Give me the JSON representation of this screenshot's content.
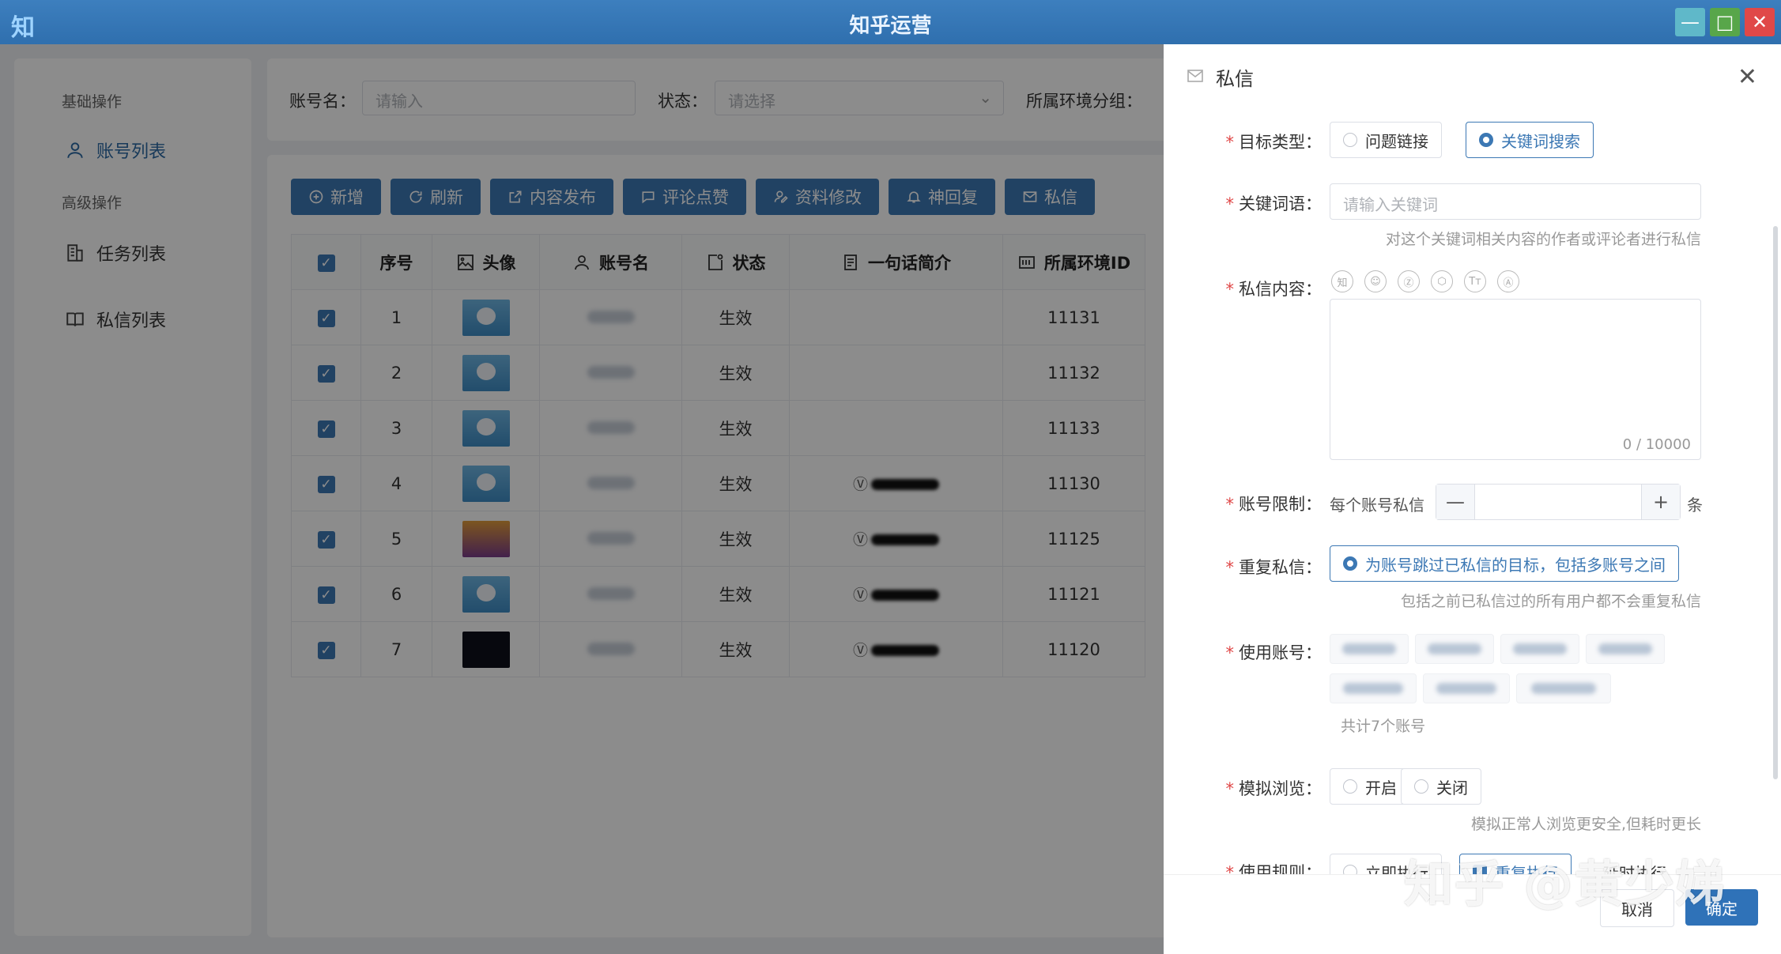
{
  "window": {
    "logo": "知",
    "title": "知乎运营",
    "controls": {
      "minimize": "—",
      "maximize": "□",
      "close": "✕"
    }
  },
  "sidebar": {
    "groups": [
      {
        "label": "基础操作"
      },
      {
        "label": "高级操作"
      }
    ],
    "items": [
      {
        "label": "账号列表",
        "icon": "user-icon"
      },
      {
        "label": "任务列表",
        "icon": "building-icon"
      },
      {
        "label": "私信列表",
        "icon": "book-icon"
      }
    ]
  },
  "filter": {
    "account_label": "账号名：",
    "account_placeholder": "请输入",
    "status_label": "状态：",
    "status_placeholder": "请选择",
    "env_label": "所属环境分组："
  },
  "toolbar": {
    "buttons": [
      {
        "label": "新增",
        "icon": "plus-circle-icon"
      },
      {
        "label": "刷新",
        "icon": "refresh-icon"
      },
      {
        "label": "内容发布",
        "icon": "external-link-icon"
      },
      {
        "label": "评论点赞",
        "icon": "comment-icon"
      },
      {
        "label": "资料修改",
        "icon": "edit-profile-icon"
      },
      {
        "label": "神回复",
        "icon": "bell-icon"
      },
      {
        "label": "私信",
        "icon": "mail-icon"
      }
    ]
  },
  "table": {
    "headers": {
      "index": "序号",
      "avatar": "头像",
      "account": "账号名",
      "status": "状态",
      "bio": "一句话简介",
      "env_id": "所属环境ID"
    },
    "rows": [
      {
        "index": "1",
        "status": "生效",
        "env_id": "11131",
        "avatar": "bear",
        "has_bio": false
      },
      {
        "index": "2",
        "status": "生效",
        "env_id": "11132",
        "avatar": "bear",
        "has_bio": false
      },
      {
        "index": "3",
        "status": "生效",
        "env_id": "11133",
        "avatar": "bear",
        "has_bio": false
      },
      {
        "index": "4",
        "status": "生效",
        "env_id": "11130",
        "avatar": "bear",
        "has_bio": true
      },
      {
        "index": "5",
        "status": "生效",
        "env_id": "11125",
        "avatar": "orange",
        "has_bio": true
      },
      {
        "index": "6",
        "status": "生效",
        "env_id": "11121",
        "avatar": "bear",
        "has_bio": true
      },
      {
        "index": "7",
        "status": "生效",
        "env_id": "11120",
        "avatar": "dark",
        "has_bio": true
      }
    ],
    "bio_prefix": "Ⓥ",
    "check_mark": "✓"
  },
  "drawer": {
    "title": "私信",
    "close": "✕",
    "target_type": {
      "label": "目标类型：",
      "options": [
        "问题链接",
        "关键词搜索"
      ],
      "selected": "关键词搜索"
    },
    "keyword": {
      "label": "关键词语：",
      "placeholder": "请输入关键词",
      "hint": "对这个关键词相关内容的作者或评论者进行私信"
    },
    "content": {
      "label": "私信内容：",
      "editor_icons": [
        "知",
        "☺",
        "Ⓩ",
        "⬡",
        "Tт",
        "Ⓐ"
      ],
      "counter": "0 / 10000"
    },
    "limit": {
      "label": "账号限制：",
      "prefix": "每个账号私信",
      "minus": "—",
      "plus": "+",
      "suffix": "条"
    },
    "repeat": {
      "label": "重复私信：",
      "option": "为账号跳过已私信的目标，包括多账号之间",
      "hint": "包括之前已私信过的所有用户都不会重复私信"
    },
    "accounts": {
      "label": "使用账号：",
      "count_text": "共计7个账号"
    },
    "browse": {
      "label": "模拟浏览：",
      "options": [
        "开启",
        "关闭"
      ],
      "hint": "模拟正常人浏览更安全,但耗时更长"
    },
    "rule": {
      "label": "使用规则：",
      "options": [
        "立即执行",
        "重复执行",
        "延时执行"
      ]
    },
    "footer": {
      "cancel": "取消",
      "confirm": "确定"
    }
  },
  "watermark": "知乎 @黄少娣",
  "colors": {
    "primary": "#3c78b4",
    "title_bar": "#2f6fae",
    "required": "#e04848"
  }
}
